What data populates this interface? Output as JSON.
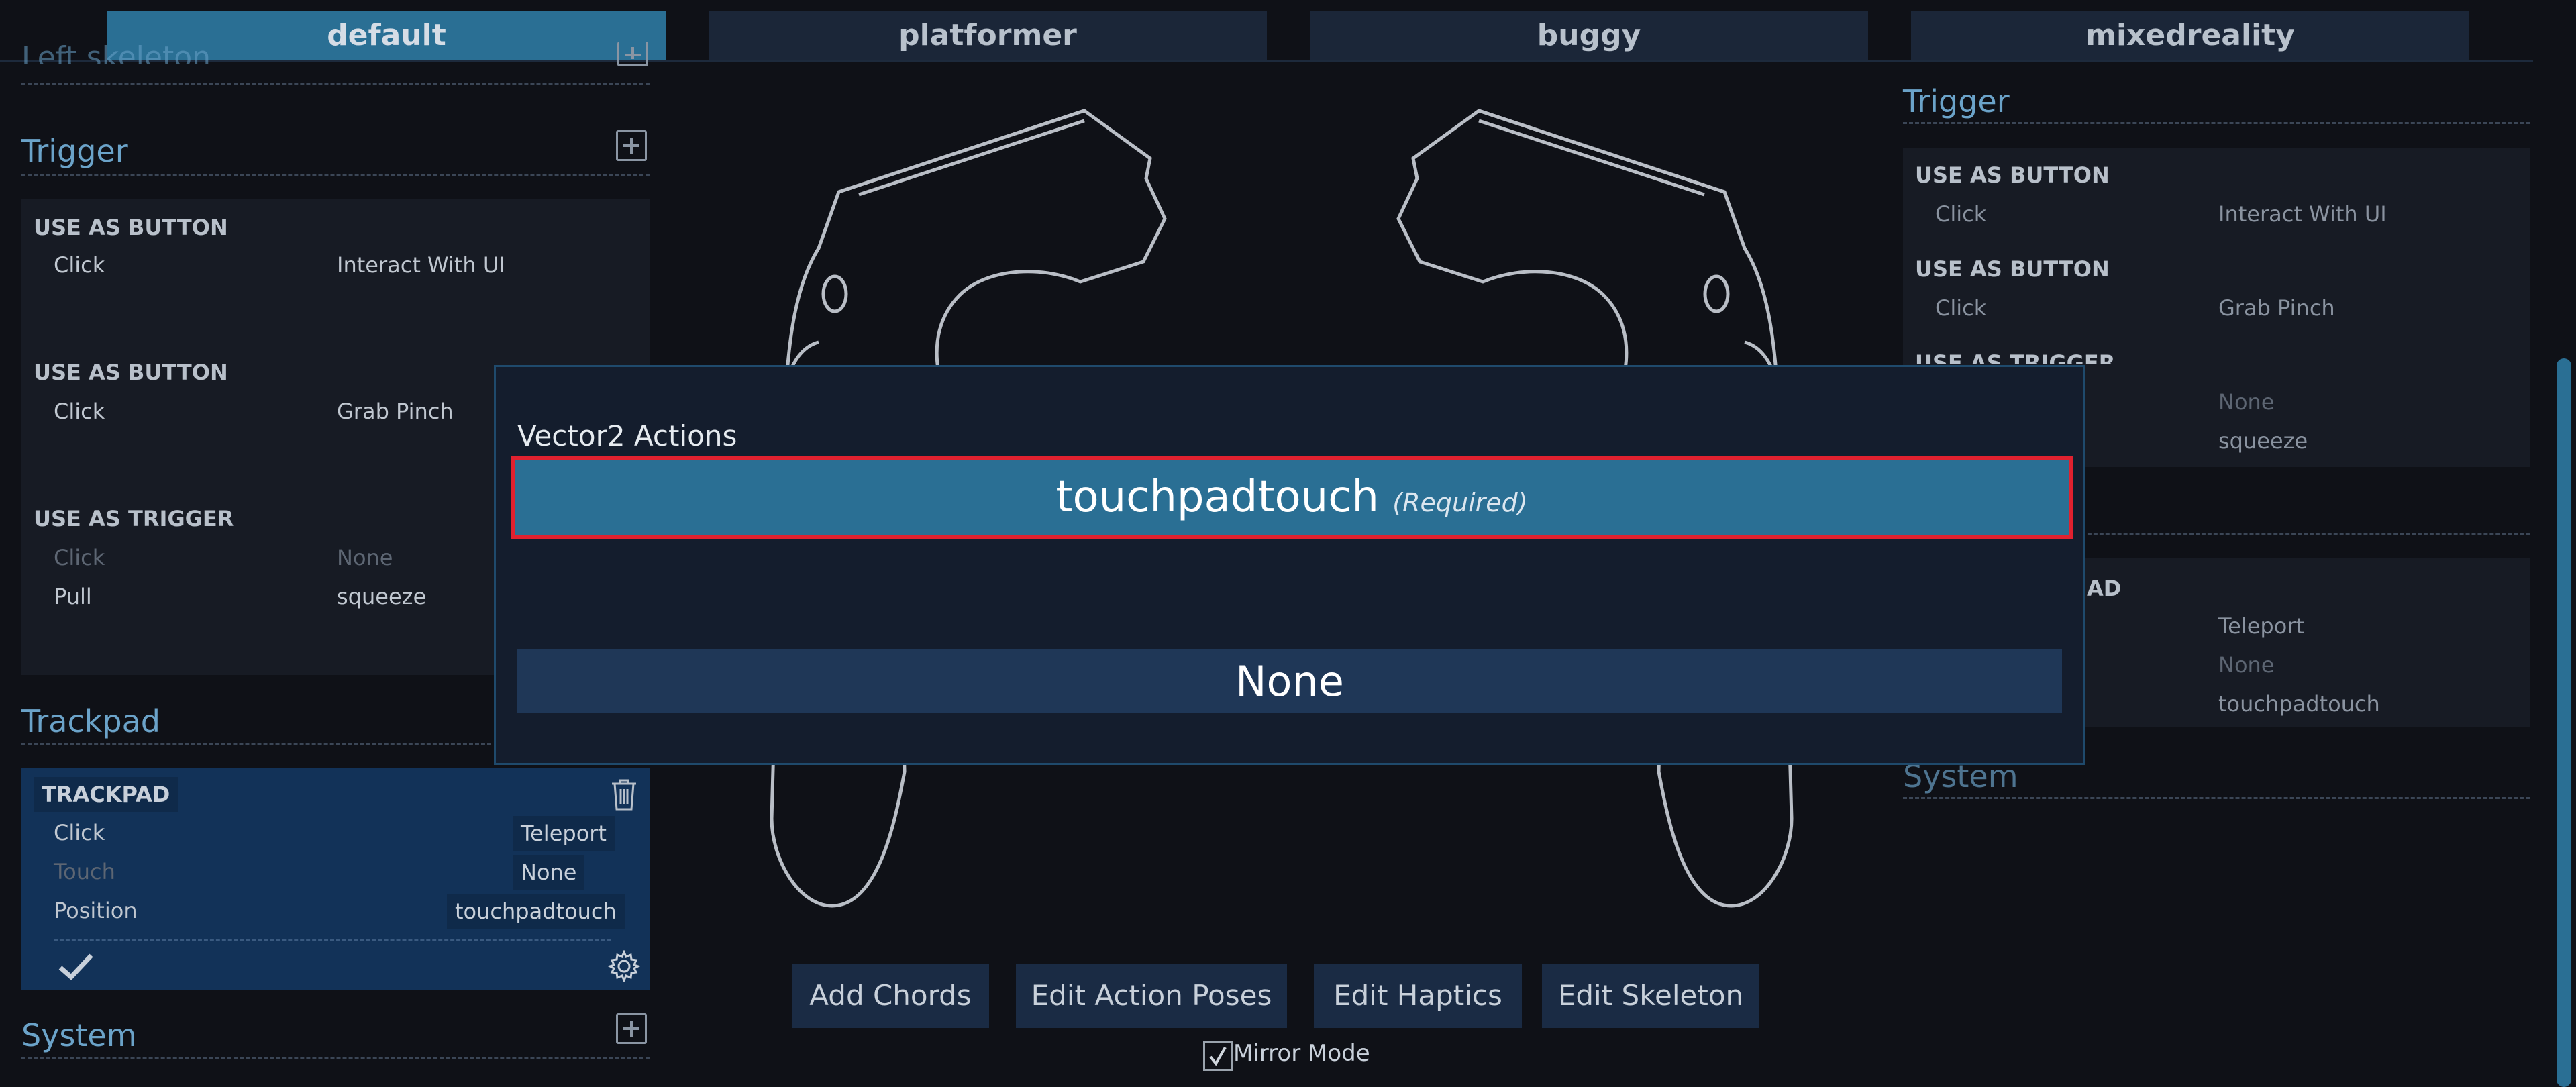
{
  "tabs": [
    "default",
    "platformer",
    "buggy",
    "mixedreality"
  ],
  "left": {
    "partial_title": "Left skeleton",
    "trigger": {
      "title": "Trigger",
      "groups": [
        {
          "header": "USE AS BUTTON",
          "rows": [
            {
              "input": "Click",
              "action": "Interact With UI"
            }
          ]
        },
        {
          "header": "USE AS BUTTON",
          "rows": [
            {
              "input": "Click",
              "action": "Grab Pinch"
            }
          ]
        },
        {
          "header": "USE AS TRIGGER",
          "rows": [
            {
              "input": "Click",
              "action": "None"
            },
            {
              "input": "Pull",
              "action": "squeeze"
            }
          ]
        }
      ]
    },
    "trackpad": {
      "title": "Trackpad",
      "card_header": "TRACKPAD",
      "rows": [
        {
          "input": "Click",
          "action": "Teleport"
        },
        {
          "input": "Touch",
          "action": "None"
        },
        {
          "input": "Position",
          "action": "touchpadtouch"
        }
      ]
    },
    "system": {
      "title": "System"
    }
  },
  "right": {
    "trigger": {
      "title": "Trigger",
      "groups": [
        {
          "header": "USE AS BUTTON",
          "rows": [
            {
              "input": "Click",
              "action": "Interact With UI"
            }
          ]
        },
        {
          "header": "USE AS BUTTON",
          "rows": [
            {
              "input": "Click",
              "action": "Grab Pinch"
            }
          ]
        },
        {
          "header": "USE AS TRIGGER",
          "rows": [
            {
              "action": "None"
            },
            {
              "action": "squeeze"
            }
          ]
        }
      ]
    },
    "trackpad": {
      "header_fragment": "AD",
      "rows": [
        {
          "action": "Teleport"
        },
        {
          "action": "None"
        },
        {
          "action": "touchpadtouch"
        }
      ]
    },
    "system": {
      "title": "System"
    }
  },
  "bottom_buttons": [
    "Add Chords",
    "Edit Action Poses",
    "Edit Haptics",
    "Edit Skeleton"
  ],
  "mirror_mode": {
    "label": "Mirror Mode",
    "checked": true
  },
  "modal": {
    "title": "Vector2 Actions",
    "options": [
      {
        "name": "touchpadtouch",
        "note": "(Required)",
        "selected": true
      },
      {
        "name": "None",
        "note": "",
        "selected": false
      }
    ]
  },
  "colors": {
    "accent": "#2a6f94",
    "highlight_border": "#e0212f",
    "section_title": "#6ba3c9"
  },
  "icons": [
    "plus-icon",
    "trash-icon",
    "check-icon",
    "gear-icon",
    "checkbox-icon"
  ]
}
